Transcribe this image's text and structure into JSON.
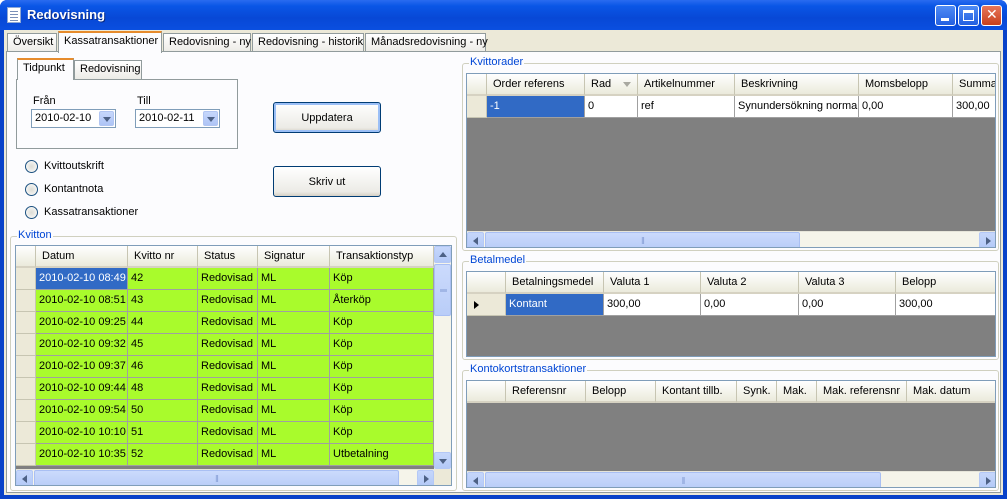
{
  "window": {
    "title": "Redovisning"
  },
  "tabs": [
    "Översikt",
    "Kassatransaktioner",
    "Redovisning - ny",
    "Redovisning - historik",
    "Månadsredovisning - ny"
  ],
  "subtabs": [
    "Tidpunkt",
    "Redovisning"
  ],
  "filter": {
    "from_label": "Från",
    "from_value": "2010-02-10",
    "to_label": "Till",
    "to_value": "2010-02-11",
    "update_label": "Uppdatera",
    "print_label": "Skriv ut"
  },
  "radios": [
    "Kvittoutskrift",
    "Kontantnota",
    "Kassatransaktioner"
  ],
  "kvitton": {
    "title": "Kvitton",
    "columns": [
      "Datum",
      "Kvitto nr",
      "Status",
      "Signatur",
      "Transaktionstyp"
    ],
    "rows": [
      [
        "2010-02-10 08:49",
        "42",
        "Redovisad",
        "ML",
        "Köp"
      ],
      [
        "2010-02-10 08:51",
        "43",
        "Redovisad",
        "ML",
        "Återköp"
      ],
      [
        "2010-02-10 09:25",
        "44",
        "Redovisad",
        "ML",
        "Köp"
      ],
      [
        "2010-02-10 09:32",
        "45",
        "Redovisad",
        "ML",
        "Köp"
      ],
      [
        "2010-02-10 09:37",
        "46",
        "Redovisad",
        "ML",
        "Köp"
      ],
      [
        "2010-02-10 09:44",
        "48",
        "Redovisad",
        "ML",
        "Köp"
      ],
      [
        "2010-02-10 09:54",
        "50",
        "Redovisad",
        "ML",
        "Köp"
      ],
      [
        "2010-02-10 10:10",
        "51",
        "Redovisad",
        "ML",
        "Köp"
      ],
      [
        "2010-02-10 10:35",
        "52",
        "Redovisad",
        "ML",
        "Utbetalning"
      ]
    ]
  },
  "kvittorader": {
    "title": "Kvittorader",
    "columns": [
      "Order referens",
      "Rad",
      "Artikelnummer",
      "Beskrivning",
      "Momsbelopp",
      "Summa"
    ],
    "rows": [
      [
        "-1",
        "0",
        "ref",
        "Synundersökning normal",
        "0,00",
        "300,00"
      ]
    ]
  },
  "betalmedel": {
    "title": "Betalmedel",
    "columns": [
      "Betalningsmedel",
      "Valuta 1",
      "Valuta 2",
      "Valuta 3",
      "Belopp"
    ],
    "rows": [
      [
        "Kontant",
        "300,00",
        "0,00",
        "0,00",
        "300,00"
      ]
    ]
  },
  "kontokort": {
    "title": "Kontokortstransaktioner",
    "columns": [
      "Referensnr",
      "Belopp",
      "Kontant tillb.",
      "Synk.",
      "Mak.",
      "Mak. referensnr",
      "Mak. datum"
    ]
  },
  "colors": {
    "titlebar": "#0a56e6",
    "row_green": "#a9fb2c",
    "selection": "#316ac5",
    "group_label": "#0046d5"
  }
}
